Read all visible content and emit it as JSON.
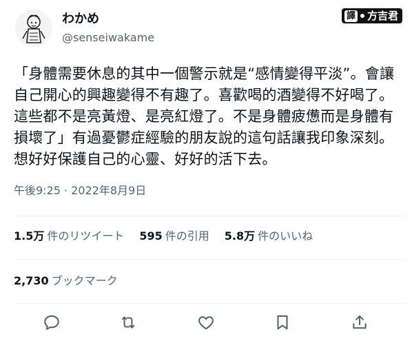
{
  "tweet": {
    "author": {
      "display_name": "わかめ",
      "handle": "@senseiwakame",
      "avatar_icon": "avatar-icon"
    },
    "translator_badge": {
      "tag": "譯",
      "name": "方吉君"
    },
    "text": "「身體需要休息的其中一個警示就是“感情變得平淡”。會讓自己開心的興趣變得不有趣了。喜歡喝的酒變得不好喝了。這些都不是亮黃燈、是亮紅燈了。不是身體疲憊而是身體有損壞了」有過憂鬱症經驗的朋友說的這句話讓我印象深刻。想好好保護自己的心靈、好好的活下去。",
    "timestamp": "午後9:25 · 2022年8月9日",
    "stats": {
      "retweets": {
        "num": "1.5万",
        "label": "件のリツイート"
      },
      "quotes": {
        "num": "595",
        "label": "件の引用"
      },
      "likes": {
        "num": "5.8万",
        "label": "件のいいね"
      }
    },
    "bookmarks": {
      "num": "2,730",
      "label": "ブックマーク"
    },
    "actions": {
      "reply_icon": "reply-icon",
      "retweet_icon": "retweet-icon",
      "like_icon": "like-icon",
      "bookmark_icon": "bookmark-icon",
      "share_icon": "share-icon"
    }
  },
  "colors": {
    "text_primary": "#0f1419",
    "text_secondary": "#536471",
    "divider": "#eff3f4",
    "badge_bg": "#111111"
  }
}
